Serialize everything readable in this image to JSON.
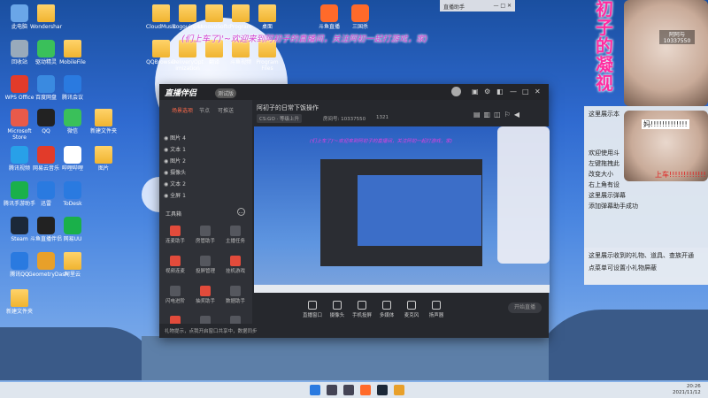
{
  "desktop": {
    "icons": [
      {
        "label": "此电脑",
        "color": "#6aa6e8"
      },
      {
        "label": "Wondershar",
        "color": "#ffd36a"
      },
      {
        "label": "CloudMusic",
        "color": "#ffd36a"
      },
      {
        "label": "Sogouinput",
        "color": "#ffd36a"
      },
      {
        "label": "LenovoSoftc",
        "color": "#ffd36a"
      },
      {
        "label": "Program",
        "color": "#ffd36a"
      },
      {
        "label": "桌面",
        "color": "#ffd36a"
      },
      {
        "label": "斗鱼直播",
        "color": "#ff6a2a"
      },
      {
        "label": "三国杀",
        "color": "#ff6a2a"
      },
      {
        "label": "回收站",
        "color": "#9ab"
      },
      {
        "label": "驱动精灵",
        "color": "#3ac05a"
      },
      {
        "label": "MobileFile",
        "color": "#ffd36a"
      },
      {
        "label": "QQBrowser",
        "color": "#ffd36a"
      },
      {
        "label": "DeliveryOpt imization",
        "color": "#ffd36a"
      },
      {
        "label": "翻译",
        "color": "#ffd36a"
      },
      {
        "label": "斗鱼视频",
        "color": "#ffd36a"
      },
      {
        "label": "Program Files",
        "color": "#ffd36a"
      },
      {
        "label": "WPS Office",
        "color": "#e23b2a"
      },
      {
        "label": "百度网盘",
        "color": "#3a8ae0"
      },
      {
        "label": "腾讯会议",
        "color": "#2a7ae0"
      },
      {
        "label": "Microsoft Store",
        "color": "#e85a4a"
      },
      {
        "label": "QQ",
        "color": "#222"
      },
      {
        "label": "微信",
        "color": "#3ac05a"
      },
      {
        "label": "新建文件夹",
        "color": "#ffd36a"
      },
      {
        "label": "腾讯视频",
        "color": "#28a0e8"
      },
      {
        "label": "网易云音乐",
        "color": "#e23b2a"
      },
      {
        "label": "哔哩哔哩",
        "color": "#fff"
      },
      {
        "label": "图片",
        "color": "#ffd36a"
      },
      {
        "label": "腾讯手游助手",
        "color": "#1ab04a"
      },
      {
        "label": "迅雷",
        "color": "#2a7ae0"
      },
      {
        "label": "ToDesk",
        "color": "#2a7ae0"
      },
      {
        "label": "Steam",
        "color": "#1b2838"
      },
      {
        "label": "斗鱼直播伴侣",
        "color": "#222"
      },
      {
        "label": "网易UU",
        "color": "#1ab04a"
      },
      {
        "label": "腾讯QQ",
        "color": "#2a7ae0"
      },
      {
        "label": "GeometryDash",
        "color": "#e8a02a"
      },
      {
        "label": "阿里云",
        "color": "#ffd36a"
      },
      {
        "label": "新建文件夹",
        "color": "#ffd36a"
      }
    ],
    "banner": "(们上车了)'~欢迎来到阿初子的直播间，关注阿初一起打游戏，家)",
    "mini_window_title": "直播助手"
  },
  "overlay": {
    "title_chars": [
      "初",
      "子",
      "的",
      "凝",
      "视"
    ],
    "viewer_name": "阿阿与",
    "viewer_id": "10337550",
    "face_label": "妈!!!!!!!!!!!!!",
    "red_text": "上车!!!!!!!!!!!!!",
    "chat_lines": [
      "这里展示本",
      "欢迎使用斗",
      "左键拖拽此",
      "改变大小",
      "右上角有设",
      "这里展示弹幕",
      "添加弹幕助手成功"
    ],
    "bottom_lines": [
      "这里展示收到的礼物、道具、查族开通",
      "点菜单可设置小礼物屏蔽"
    ]
  },
  "app": {
    "logo": "直播伴侣",
    "badge": "测试版",
    "stream_title": "阿初子的日常下饭操作",
    "category": "CS:GO · 等级上升",
    "room_id": "房间号: 10337550",
    "online": "1321",
    "tabs": [
      {
        "label": "场景选项",
        "active": true
      },
      {
        "label": "节点",
        "active": false
      },
      {
        "label": "可推送",
        "active": false
      }
    ],
    "scenes": [
      "图片 4",
      "文本 1",
      "图片 2",
      "摄像头",
      "文本 2",
      "全屏 1"
    ],
    "tools_header": "工具箱",
    "tools": [
      {
        "label": "连麦助手",
        "red": true
      },
      {
        "label": "房管助手",
        "red": false
      },
      {
        "label": "主播任务",
        "red": false
      },
      {
        "label": "视频连麦",
        "red": true
      },
      {
        "label": "投屏管理",
        "red": false
      },
      {
        "label": "挂机游戏",
        "red": true
      },
      {
        "label": "闪电进阶",
        "red": false
      },
      {
        "label": "抽奖助手",
        "red": true
      },
      {
        "label": "数据助手",
        "red": false
      },
      {
        "label": "粉丝会",
        "red": true
      },
      {
        "label": "",
        "red": false
      },
      {
        "label": "",
        "red": false
      }
    ],
    "controls": [
      "直播窗口",
      "摄像头",
      "手机投屏",
      "多媒体",
      "麦克风",
      "扬声器"
    ],
    "live_button": "开始直播",
    "status": "礼物提示，点我开启窗口共享中，数据同步"
  },
  "taskbar": {
    "icons": [
      {
        "name": "windows-icon",
        "color": "#2a7ae0"
      },
      {
        "name": "search-icon",
        "color": "#445"
      },
      {
        "name": "taskview-icon",
        "color": "#445"
      },
      {
        "name": "douyu-icon",
        "color": "#ff6a2a"
      },
      {
        "name": "steam-icon",
        "color": "#1b2838"
      },
      {
        "name": "app-icon",
        "color": "#e8a02a"
      }
    ],
    "time": "20:26",
    "date": "2021/11/12"
  }
}
